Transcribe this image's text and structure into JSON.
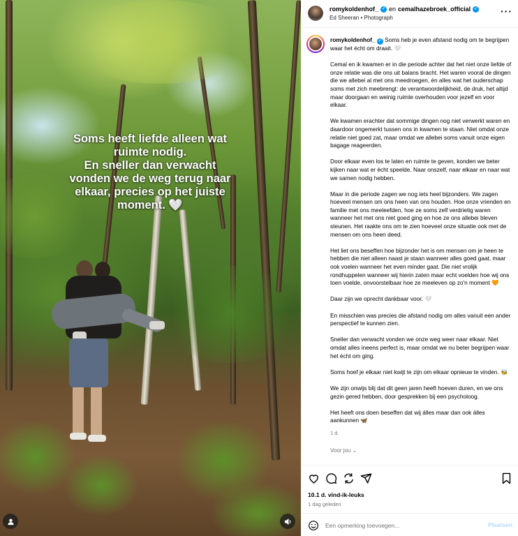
{
  "media": {
    "overlay_lines": [
      "Soms heeft liefde alleen wat",
      "ruimte nodig.",
      "En sneller dan verwacht",
      "vonden we de weg terug naar",
      "elkaar, precies op het juiste",
      "moment. 🤍"
    ],
    "user_icon": "user-tag-icon",
    "sound_icon": "sound-on-icon"
  },
  "header": {
    "user1": "romykoldenhof_",
    "and_text": "en",
    "user2": "cemalhazebroek_official",
    "subtitle": "Ed Sheeran • Photograph"
  },
  "caption": {
    "username": "romykoldenhof_",
    "paragraphs": [
      "Soms heb je even afstand nodig om te begrijpen waar het écht om draait. 🤍",
      "Cemal en ik kwamen er in die periode achter dat het niet onze liefde of onze relatie was die ons uit balans bracht. Het waren vooral de dingen die we allebei al met ons meedroegen, én alles wat het ouderschap soms met zich meebrengt: de verantwoordelijkheid, de druk, het altijd maar doorgaan en weinig ruimte overhouden voor jezelf en voor elkaar.",
      "We kwamen erachter dat sommige dingen nog niet verwerkt waren en daardoor ongemerkt tussen ons in kwamen te staan. Niet omdat onze relatie niet goed zat, maar omdat we allebei soms vanuit onze eigen bagage reageerden.",
      "Door elkaar even los te laten en ruimte te geven, konden we beter kijken naar wat er écht speelde. Naar onszelf, naar elkaar en naar wat we samen nodig hebben.",
      "Maar in die periode zagen we nog iets heel bijzonders. We zagen hoeveel mensen om ons heen van ons houden. Hoe onze vrienden en familie met ons meeleefden, hoe ze soms zelf verdrietig waren wanneer het met ons niet goed ging en hoe ze ons allebei bleven steunen. Het raakte ons om te zien hoeveel onze situatie ook met de mensen om ons heen deed.",
      "Het liet ons beseffen hoe bijzonder het is om mensen om je heen te hebben die niet alleen naast je staan wanneer alles goed gaat, maar ook voelen wanneer het even minder gaat. Die niet vrolijk rondhuppelen wanneer wij hierin zaten maar echt voelden hoe wij ons toen voelde, onvoorstelbaar hoe ze meeleven op zo'n moment 🧡",
      "Daar zijn we oprecht dankbaar voor. 🤍",
      "En misschien was precies die afstand nodig om alles vanuit een ander perspectief te kunnen zien.",
      "Sneller dan verwacht vonden we onze weg weer naar elkaar. Niet omdat alles ineens perfect is, maar omdat we nu beter begrijpen waar het écht om ging.",
      "Soms hoef je elkaar niet kwijt te zijn om elkaar opnieuw te vinden. 🐝",
      "We zijn onwijs blij dat dit geen jaren heeft hoeven duren, en we ons gezin gered hebben, door gesprekken bij een psycholoog.",
      "Het heeft ons doen beseffen dat wij álles maar dan ook álles aankunnen 🦋"
    ],
    "time": "1 d.",
    "for_you": "Voor jou ⌄"
  },
  "actions": {
    "likes": "10.1 d. vind-ik-leuks",
    "date": "1 dag geleden",
    "icons": [
      "heart-icon",
      "comment-icon",
      "share-icon",
      "send-icon",
      "save-icon"
    ]
  },
  "comment": {
    "placeholder": "Een opmerking toevoegen...",
    "post_label": "Plaatsen",
    "emoji_icon": "emoji-icon"
  },
  "colors": {
    "accent": "#0095f6",
    "post_disabled": "#b3dbff",
    "secondary_text": "#737373"
  }
}
